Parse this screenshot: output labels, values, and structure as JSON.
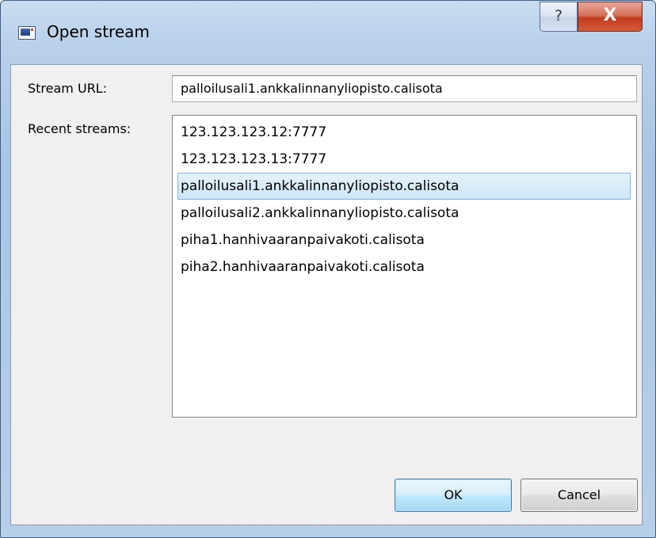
{
  "window": {
    "title": "Open stream",
    "icon": "application-window-icon",
    "help_label": "?",
    "close_label": "X"
  },
  "form": {
    "stream_url_label": "Stream URL:",
    "stream_url_value": "palloilusali1.ankkalinnanyliopisto.calisota",
    "recent_streams_label": "Recent streams:"
  },
  "recent_streams": {
    "items": [
      {
        "label": "123.123.123.12:7777",
        "selected": false
      },
      {
        "label": "123.123.123.13:7777",
        "selected": false
      },
      {
        "label": "palloilusali1.ankkalinnanyliopisto.calisota",
        "selected": true
      },
      {
        "label": "palloilusali2.ankkalinnanyliopisto.calisota",
        "selected": false
      },
      {
        "label": "piha1.hanhivaaranpaivakoti.calisota",
        "selected": false
      },
      {
        "label": "piha2.hanhivaaranpaivakoti.calisota",
        "selected": false
      }
    ],
    "selected_index": 2
  },
  "buttons": {
    "ok_label": "OK",
    "cancel_label": "Cancel"
  },
  "colors": {
    "selection_background": "#cde6f7",
    "selection_border": "#7cb5e6",
    "close_button": "#c13b21",
    "default_button_border": "#3c7fb1"
  }
}
